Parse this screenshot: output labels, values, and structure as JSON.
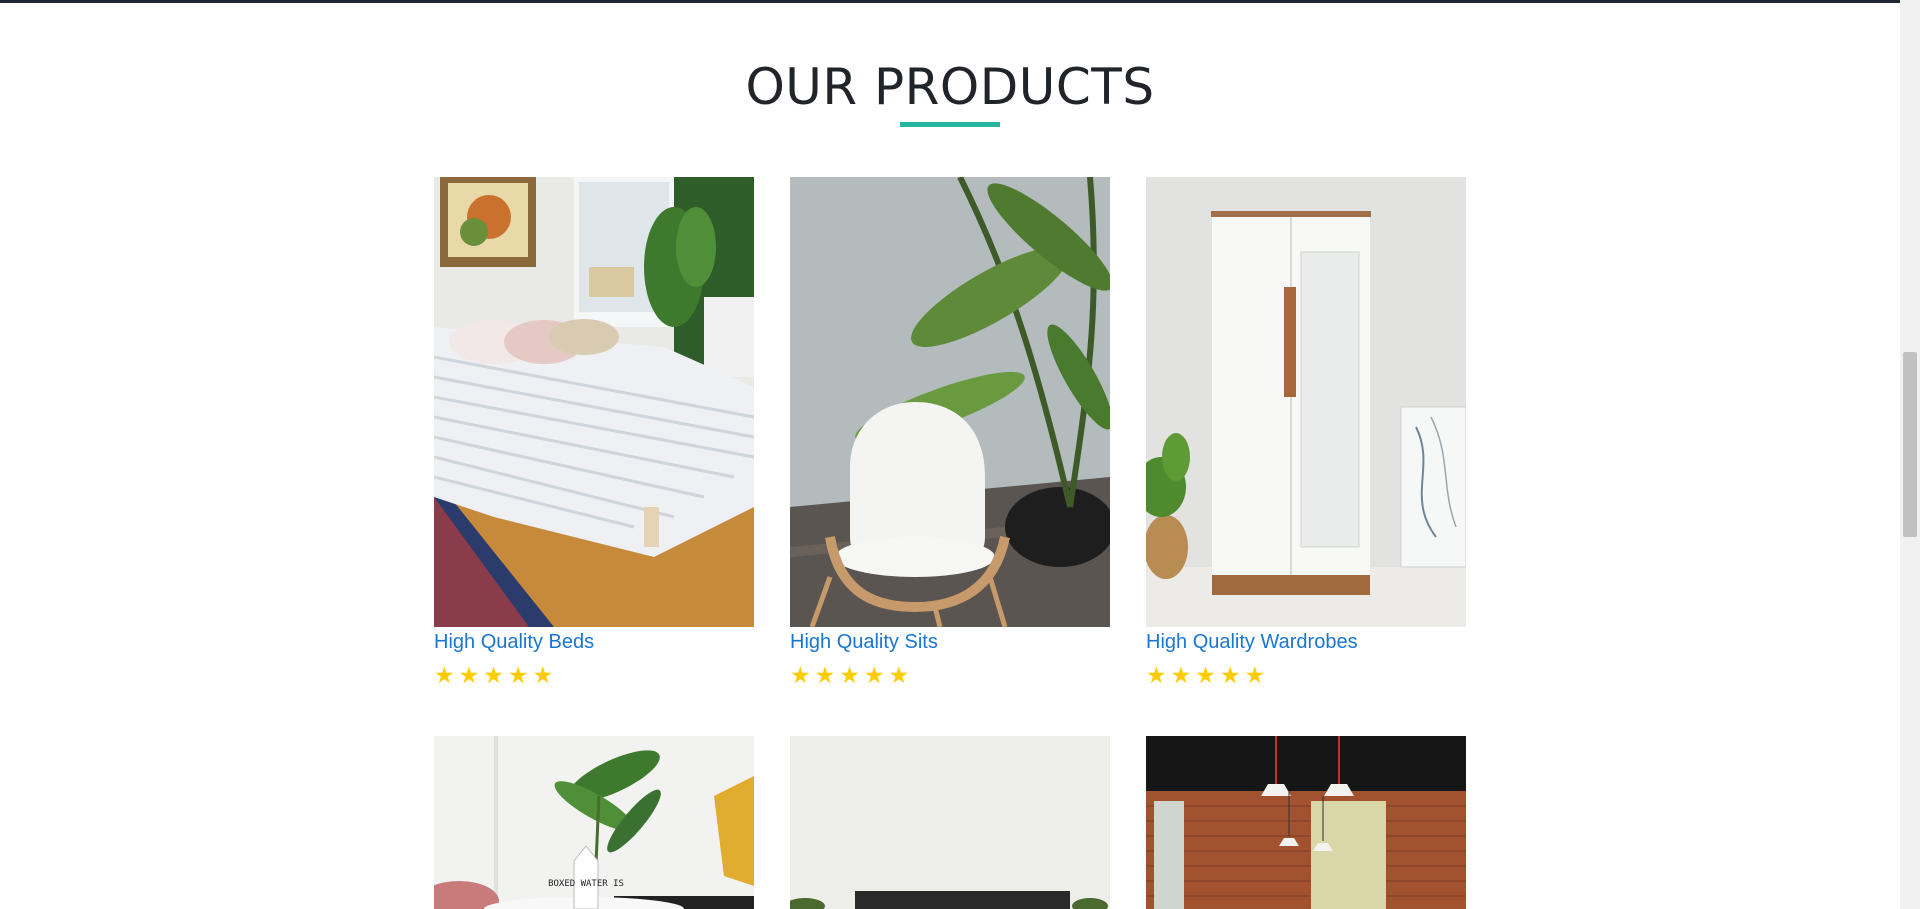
{
  "section": {
    "title": "OUR PRODUCTS"
  },
  "products": [
    {
      "title": "High Quality Beds",
      "rating": 5
    },
    {
      "title": "High Quality Sits",
      "rating": 5
    },
    {
      "title": "High Quality Wardrobes",
      "rating": 5
    }
  ],
  "next_row_images": [
    "bed-room-photo",
    "tv-stand-photo",
    "dining-room-photo"
  ],
  "next_row_image_text": "BOXED WATER IS",
  "colors": {
    "accent": "#26b5a3",
    "link": "#1976d2",
    "star": "#ffcc00",
    "heading": "#212529"
  },
  "icons": {
    "star": "star-icon"
  }
}
